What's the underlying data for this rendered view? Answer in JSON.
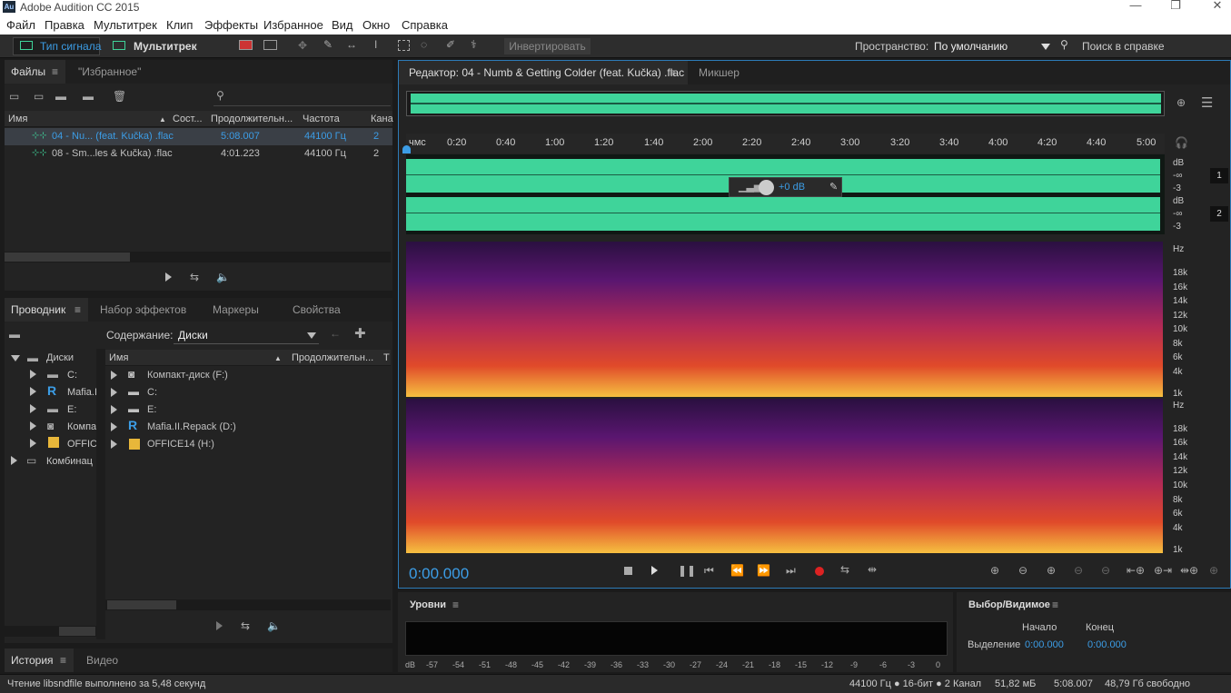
{
  "window": {
    "app_icon": "Au",
    "title": "Adobe Audition CC 2015",
    "min": "—",
    "max": "❐",
    "close": "✕"
  },
  "menu": [
    "Файл",
    "Правка",
    "Мультитрек",
    "Клип",
    "Эффекты",
    "Избранное",
    "Вид",
    "Окно",
    "Справка"
  ],
  "toolbar": {
    "waveform": "Тип сигнала",
    "multitrack": "Мультитрек",
    "invert": "Инвертировать",
    "workspace_label": "Пространство:",
    "workspace_value": "По умолчанию",
    "help_search": "Поиск в справке"
  },
  "files_panel": {
    "tab_files": "Файлы",
    "tab_favorites": "\"Избранное\"",
    "columns": [
      "Имя",
      "Сост...",
      "Продолжительн...",
      "Частота",
      "Кана"
    ],
    "rows": [
      {
        "name": "04 - Nu... (feat. Kučka) .flac",
        "duration": "5:08.007",
        "rate": "44100 Гц",
        "channels": "2"
      },
      {
        "name": "08 - Sm...les & Kučka) .flac",
        "duration": "4:01.223",
        "rate": "44100 Гц",
        "channels": "2"
      }
    ]
  },
  "explorer": {
    "tabs": [
      "Проводник",
      "Набор эффектов",
      "Маркеры",
      "Свойства"
    ],
    "content_label": "Содержание:",
    "content_value": "Диски",
    "tree": [
      "Диски",
      "C:",
      "Mafia.I",
      "E:",
      "Компа",
      "OFFICE",
      "Комбинац"
    ],
    "columns": [
      "Имя",
      "Продолжительн...",
      "Т"
    ],
    "items": [
      "Компакт-диск (F:)",
      "C:",
      "E:",
      "Mafia.II.Repack (D:)",
      "OFFICE14 (H:)"
    ]
  },
  "history": {
    "tabs": [
      "История",
      "Видео"
    ]
  },
  "editor": {
    "tab": "Редактор: 04 - Numb & Getting Colder (feat. Kučka) .flac",
    "mixer": "Микшер",
    "timecode": "0:00.000",
    "gain": "+0 dB",
    "ticks": [
      "чмс",
      "0:20",
      "0:40",
      "1:00",
      "1:20",
      "1:40",
      "2:00",
      "2:20",
      "2:40",
      "3:00",
      "3:20",
      "3:40",
      "4:00",
      "4:20",
      "4:40",
      "5:00"
    ],
    "db1": [
      "dB",
      "-∞",
      "-3"
    ],
    "db2": [
      "dB",
      "-∞",
      "-3"
    ],
    "ch1": "1",
    "ch2": "2",
    "hz": [
      "Hz",
      "18k",
      "16k",
      "14k",
      "12k",
      "10k",
      "8k",
      "6k",
      "4k",
      "1k"
    ]
  },
  "levels": {
    "title": "Уровни",
    "scale": [
      "dB",
      "-57",
      "-54",
      "-51",
      "-48",
      "-45",
      "-42",
      "-39",
      "-36",
      "-33",
      "-30",
      "-27",
      "-24",
      "-21",
      "-18",
      "-15",
      "-12",
      "-9",
      "-6",
      "-3",
      "0"
    ]
  },
  "selection": {
    "title": "Выбор/Видимое",
    "start": "Начало",
    "end": "Конец",
    "row": "Выделение",
    "start_val": "0:00.000",
    "end_val": "0:00.000"
  },
  "status": {
    "left": "Чтение libsndfile выполнено за 5,48 секунд",
    "format": "44100 Гц ● 16-бит ● 2 Канал",
    "size": "51,82 мБ",
    "duration": "5:08.007",
    "free": "48,79 Гб свободно"
  },
  "colors": {
    "accent": "#3c9de6",
    "wave": "#3fd49a"
  }
}
